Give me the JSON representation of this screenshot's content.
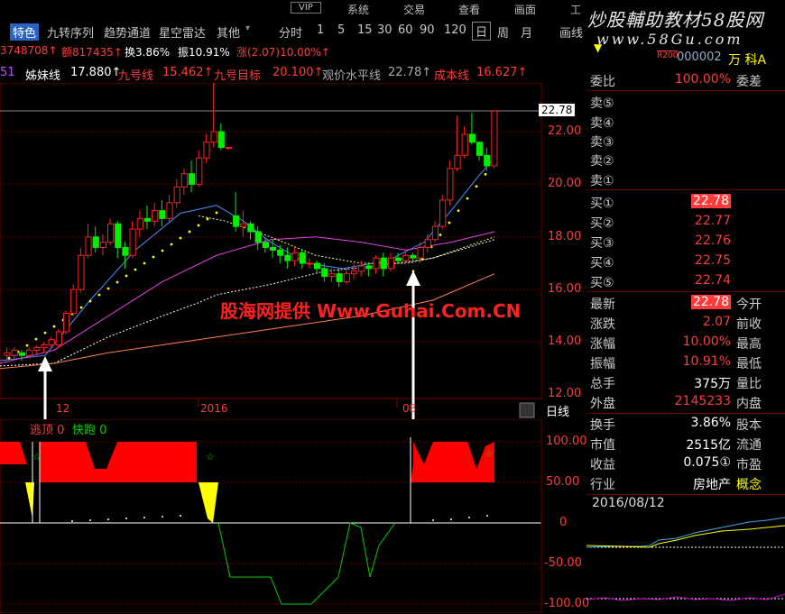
{
  "menu": [
    "VIP",
    "系统",
    "交易",
    "查看",
    "画面",
    "工"
  ],
  "toolbar": {
    "items": [
      "特色",
      "九转序列",
      "趋势通道",
      "星空雷达",
      "其他",
      "分时",
      "1",
      "5",
      "15",
      "30",
      "60",
      "90",
      "120",
      "日",
      "周",
      "月",
      "画线"
    ]
  },
  "info_row1": {
    "vol": "3748708↑",
    "amount": "额817435↑",
    "turnover": "换3.86%",
    "amplitude": "振10.91%",
    "change": "涨(2.07)10.00%↑"
  },
  "info_row2": {
    "prefix": "51",
    "sister_label": "姊妹线",
    "sister_val": "17.880↑",
    "nine_label": "九号线",
    "nine_val": "15.462↑",
    "nine_target_label": "九号目标",
    "nine_target_val": "20.100↑",
    "observe_label": "观价水平线",
    "observe_val": "22.78↑",
    "cost_label": "成本线",
    "cost_val": "16.627↑"
  },
  "stock_header": {
    "tag": "R200",
    "code": "000002",
    "suffix": "万 科A"
  },
  "logo": {
    "title": "炒股輔助教材58股网",
    "url": "www.58Gu.com"
  },
  "price_axis": [
    "22.00",
    "20.00",
    "18.00",
    "16.00",
    "14.00",
    "12.00"
  ],
  "price_tag": "22.78",
  "date_axis": [
    "12",
    "2016",
    "08"
  ],
  "period_label": "日线",
  "lower_labels": {
    "escape": "逃顶 0",
    "fast": "快跑 0"
  },
  "lower_axis": [
    "100.00",
    "50.00",
    "0",
    "-50.00",
    "-100.00"
  ],
  "watermark": "股海网提供 Www.Guhai.Com.CN",
  "quote": {
    "weibi_label": "委比",
    "weibi_val": "100.00%",
    "weicha_label": "委差",
    "sell": [
      {
        "label": "卖⑤",
        "price": ""
      },
      {
        "label": "卖④",
        "price": ""
      },
      {
        "label": "卖③",
        "price": ""
      },
      {
        "label": "卖②",
        "price": ""
      },
      {
        "label": "卖①",
        "price": ""
      }
    ],
    "buy": [
      {
        "label": "买①",
        "price": "22.78"
      },
      {
        "label": "买②",
        "price": "22.77"
      },
      {
        "label": "买③",
        "price": "22.76"
      },
      {
        "label": "买④",
        "price": "22.75"
      },
      {
        "label": "买⑤",
        "price": "22.74"
      }
    ],
    "stats": [
      {
        "label": "最新",
        "val": "22.78",
        "right": "今开"
      },
      {
        "label": "涨跌",
        "val": "2.07",
        "right": "前收"
      },
      {
        "label": "涨幅",
        "val": "10.00%",
        "right": "最高"
      },
      {
        "label": "振幅",
        "val": "10.91%",
        "right": "最低"
      },
      {
        "label": "总手",
        "val": "375万",
        "right": "量比"
      },
      {
        "label": "外盘",
        "val": "2145233",
        "right": "内盘"
      }
    ],
    "stats2": [
      {
        "label": "换手",
        "val": "3.86%",
        "right": "股本"
      },
      {
        "label": "市值",
        "val": "2515亿",
        "right": "流通"
      },
      {
        "label": "收益",
        "val": "0.075①",
        "right": "市盈"
      },
      {
        "label": "行业",
        "val": "房地产",
        "right": "概念"
      }
    ]
  },
  "mini_chart_date": "2016/08/12"
}
